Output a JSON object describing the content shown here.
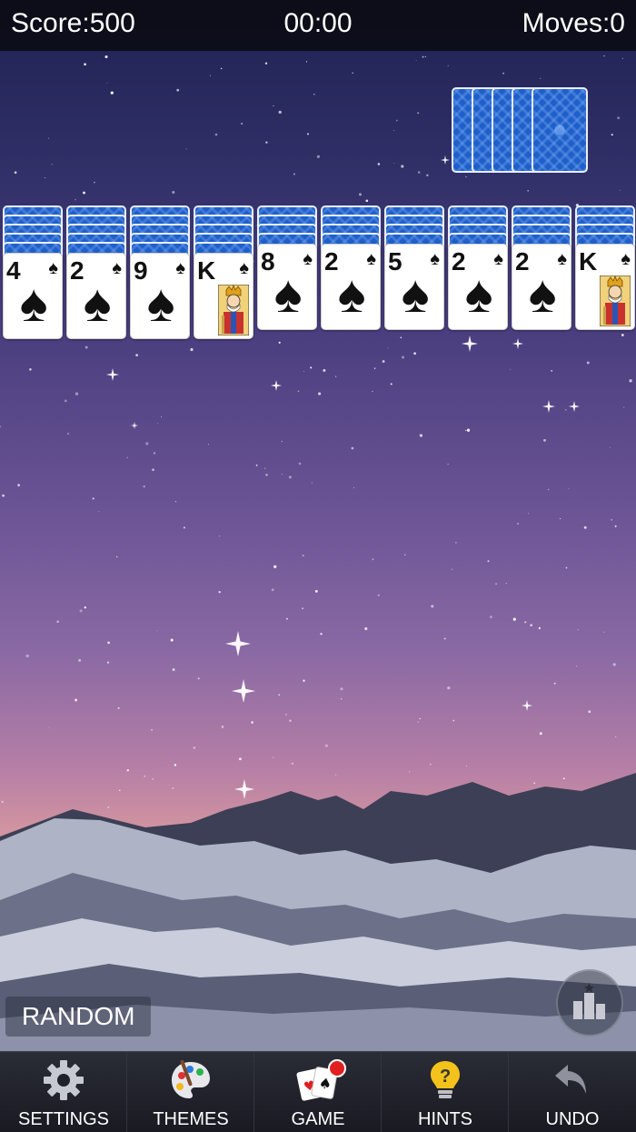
{
  "status": {
    "score": "Score:500",
    "timer": "00:00",
    "moves": "Moves:0"
  },
  "stock": {
    "piles": 5
  },
  "tableau": [
    {
      "rank": "4",
      "suit": "spade",
      "face_down": 5
    },
    {
      "rank": "2",
      "suit": "spade",
      "face_down": 5
    },
    {
      "rank": "9",
      "suit": "spade",
      "face_down": 5
    },
    {
      "rank": "K",
      "suit": "spade",
      "face_down": 5
    },
    {
      "rank": "8",
      "suit": "spade",
      "face_down": 4
    },
    {
      "rank": "2",
      "suit": "spade",
      "face_down": 4
    },
    {
      "rank": "5",
      "suit": "spade",
      "face_down": 4
    },
    {
      "rank": "2",
      "suit": "spade",
      "face_down": 4
    },
    {
      "rank": "2",
      "suit": "spade",
      "face_down": 4
    },
    {
      "rank": "K",
      "suit": "spade",
      "face_down": 4
    }
  ],
  "mode_label": "RANDOM",
  "toolbar": {
    "settings": "SETTINGS",
    "themes": "THEMES",
    "game": "GAME",
    "hints": "HINTS",
    "undo": "UNDO"
  },
  "colors": {
    "card_back": "#1f5fc9",
    "notification": "#e02020",
    "hint_bulb": "#f3c21b"
  }
}
